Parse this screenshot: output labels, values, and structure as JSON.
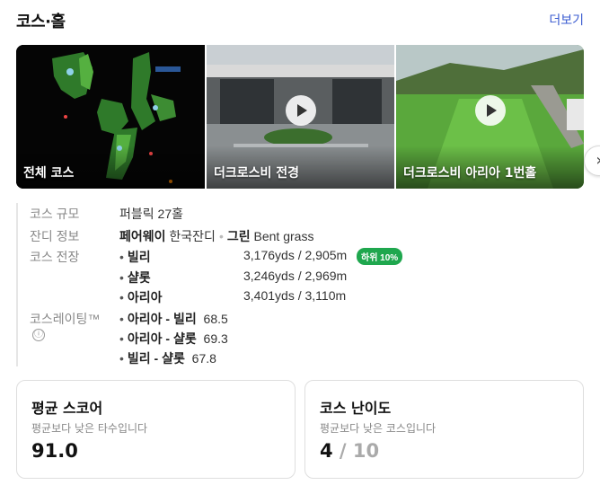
{
  "header": {
    "title": "코스·홀",
    "more_label": "더보기"
  },
  "carousel": {
    "cards": [
      {
        "label": "전체 코스",
        "map_tags": [
          "ORTHOPHOTO",
          "HOLE",
          "HOLE",
          "HOLE"
        ]
      },
      {
        "label": "더크로스비 전경"
      },
      {
        "label": "더크로스비 아리아 1번홀"
      }
    ],
    "next_icon": "›"
  },
  "info": {
    "scale": {
      "label": "코스 규모",
      "value": "퍼블릭 27홀"
    },
    "turf": {
      "label": "잔디 정보",
      "fairway": "페어웨이",
      "fairway_value": "한국잔디",
      "green": "그린",
      "green_value": "Bent grass"
    },
    "length": {
      "label": "코스 전장",
      "items": [
        {
          "name": "빌리",
          "yards": "3,176yds / 2,905m",
          "badge": "하위 10%"
        },
        {
          "name": "샬롯",
          "yards": "3,246yds / 2,969m"
        },
        {
          "name": "아리아",
          "yards": "3,401yds / 3,110m"
        }
      ]
    },
    "rating": {
      "label": "코스레이팅™",
      "info_icon": "ⓘ",
      "items": [
        {
          "name": "아리아 - 빌리",
          "value": "68.5"
        },
        {
          "name": "아리아 - 샬롯",
          "value": "69.3"
        },
        {
          "name": "빌리 - 샬롯",
          "value": "67.8"
        }
      ]
    }
  },
  "stats": {
    "avg_score": {
      "title": "평균 스코어",
      "sub": "평균보다 낮은 타수입니다",
      "value": "91.0"
    },
    "difficulty": {
      "title": "코스 난이도",
      "sub": "평균보다 낮은 코스입니다",
      "value": "4",
      "denominator": " / 10"
    }
  },
  "colors": {
    "accent_link": "#3a5bd0",
    "badge_green": "#1fa74e"
  }
}
